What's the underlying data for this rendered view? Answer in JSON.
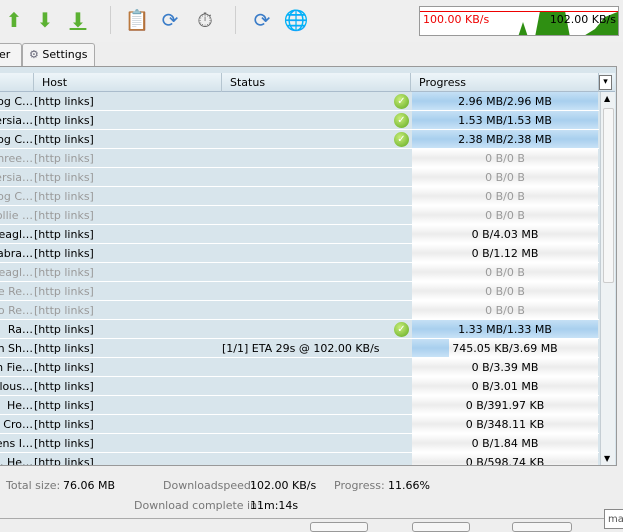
{
  "toolbar": {
    "buttons": [
      "start-icon",
      "pause-icon",
      "stop-icon",
      "clipboard-icon",
      "reconnect-icon",
      "speedometer-icon",
      "update-icon",
      "premium-icon"
    ],
    "speed_limit": "100.00 KB/s",
    "current_speed": "102.00 KB/s",
    "colors": {
      "limit": "#e00000",
      "graph": "#2f8f12"
    }
  },
  "tabs": [
    {
      "label": "er"
    },
    {
      "label": "Settings"
    }
  ],
  "columns": [
    "Host",
    "Status",
    "Progress"
  ],
  "rows": [
    {
      "name": "og C…",
      "host": "[http links]",
      "status": "",
      "progress": "2.96 MB/2.96 MB",
      "pct": 100,
      "done": true,
      "grey": false
    },
    {
      "name": "ersia…",
      "host": "[http links]",
      "status": "",
      "progress": "1.53 MB/1.53 MB",
      "pct": 100,
      "done": true,
      "grey": false
    },
    {
      "name": "og C…",
      "host": "[http links]",
      "status": "",
      "progress": "2.38 MB/2.38 MB",
      "pct": 100,
      "done": true,
      "grey": false
    },
    {
      "name": "hree…",
      "host": "[http links]",
      "status": "",
      "progress": "0 B/0 B",
      "pct": 0,
      "done": false,
      "grey": true
    },
    {
      "name": "ersia…",
      "host": "[http links]",
      "status": "",
      "progress": "0 B/0 B",
      "pct": 0,
      "done": false,
      "grey": true
    },
    {
      "name": "og C…",
      "host": "[http links]",
      "status": "",
      "progress": "0 B/0 B",
      "pct": 0,
      "done": false,
      "grey": true
    },
    {
      "name": "ollie …",
      "host": "[http links]",
      "status": "",
      "progress": "0 B/0 B",
      "pct": 0,
      "done": false,
      "grey": true
    },
    {
      "name": "eagl…",
      "host": "[http links]",
      "status": "",
      "progress": "0 B/4.03 MB",
      "pct": 0,
      "done": false,
      "grey": false
    },
    {
      "name": "abra…",
      "host": "[http links]",
      "status": "",
      "progress": "0 B/1.12 MB",
      "pct": 0,
      "done": false,
      "grey": false
    },
    {
      "name": "eagl…",
      "host": "[http links]",
      "status": "",
      "progress": "0 B/0 B",
      "pct": 0,
      "done": false,
      "grey": true
    },
    {
      "name": "e Re…",
      "host": "[http links]",
      "status": "",
      "progress": "0 B/0 B",
      "pct": 0,
      "done": false,
      "grey": true
    },
    {
      "name": "o Re…",
      "host": "[http links]",
      "status": "",
      "progress": "0 B/0 B",
      "pct": 0,
      "done": false,
      "grey": true
    },
    {
      "name": "Ra…",
      "host": "[http links]",
      "status": "",
      "progress": "1.33 MB/1.33 MB",
      "pct": 100,
      "done": true,
      "grey": false
    },
    {
      "name": "n Sh…",
      "host": "[http links]",
      "status": "[1/1] ETA 29s @ 102.00 KB/s",
      "progress": "745.05 KB/3.69 MB",
      "pct": 20,
      "done": false,
      "grey": false
    },
    {
      "name": "n Fie…",
      "host": "[http links]",
      "status": "",
      "progress": "0 B/3.39 MB",
      "pct": 0,
      "done": false,
      "grey": false
    },
    {
      "name": "lous…",
      "host": "[http links]",
      "status": "",
      "progress": "0 B/3.01 MB",
      "pct": 0,
      "done": false,
      "grey": false
    },
    {
      "name": "He…",
      "host": "[http links]",
      "status": "",
      "progress": "0 B/391.97 KB",
      "pct": 0,
      "done": false,
      "grey": false
    },
    {
      "name": "Cro…",
      "host": "[http links]",
      "status": "",
      "progress": "0 B/348.11 KB",
      "pct": 0,
      "done": false,
      "grey": false
    },
    {
      "name": "ens I…",
      "host": "[http links]",
      "status": "",
      "progress": "0 B/1.84 MB",
      "pct": 0,
      "done": false,
      "grey": false
    },
    {
      "name": ". He…",
      "host": "[http links]",
      "status": "",
      "progress": "0 B/598.74 KB",
      "pct": 0,
      "done": false,
      "grey": false
    }
  ],
  "summary": {
    "total_label": "Total size:",
    "total": "76.06 MB",
    "speed_label": "Downloadspeed:",
    "speed": "102.00 KB/s",
    "progress_label": "Progress:",
    "progress": "11.66%",
    "eta_label": "Download complete in:",
    "eta": "11m:14s"
  },
  "tooltip": "ma"
}
